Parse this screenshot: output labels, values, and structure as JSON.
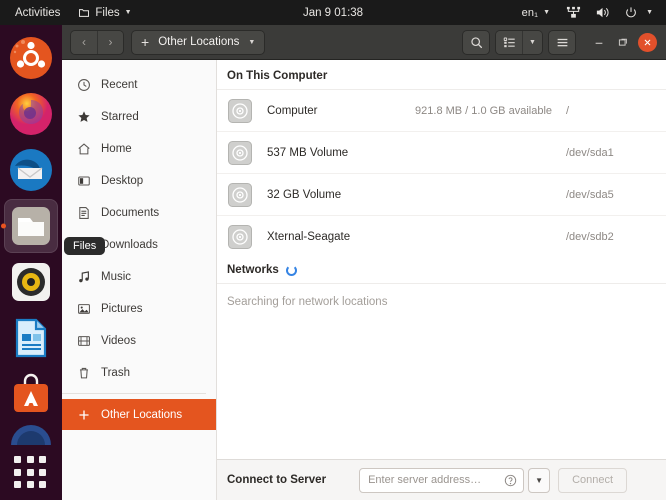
{
  "topbar": {
    "activities": "Activities",
    "app_menu": "Files",
    "app_icon": "folder-icon",
    "clock": "Jan 9  01:38",
    "language": "en₁",
    "network_icon": "network-icon",
    "volume_icon": "volume-icon",
    "power_icon": "power-icon",
    "caret_icon": "chevron-down-icon"
  },
  "dock": {
    "items": [
      {
        "name": "ubuntu-logo-icon",
        "label": "Ubuntu"
      },
      {
        "name": "firefox-icon",
        "label": "Firefox"
      },
      {
        "name": "thunderbird-icon",
        "label": "Thunderbird"
      },
      {
        "name": "files-icon",
        "label": "Files"
      },
      {
        "name": "rhythmbox-icon",
        "label": "Rhythmbox"
      },
      {
        "name": "libreoffice-writer-icon",
        "label": "LibreOffice Writer"
      },
      {
        "name": "ubuntu-software-icon",
        "label": "Ubuntu Software"
      },
      {
        "name": "help-icon",
        "label": "Help"
      }
    ],
    "show_apps_label": "Show Applications",
    "active_index": 3
  },
  "headerbar": {
    "back_icon": "chevron-left-icon",
    "forward_icon": "chevron-right-icon",
    "path_plus": "+",
    "path_label": "Other Locations",
    "path_caret_icon": "chevron-down-icon",
    "search_icon": "search-icon",
    "view_list_icon": "list-view-icon",
    "view_caret_icon": "chevron-down-icon",
    "menu_icon": "hamburger-menu-icon",
    "minimize_icon": "minimize-icon",
    "maximize_icon": "maximize-icon",
    "close_icon": "close-icon"
  },
  "sidebar": {
    "items": [
      {
        "label": "Recent",
        "icon": "clock-icon",
        "selected": false
      },
      {
        "label": "Starred",
        "icon": "star-icon",
        "selected": false
      },
      {
        "label": "Home",
        "icon": "home-icon",
        "selected": false
      },
      {
        "label": "Desktop",
        "icon": "desktop-icon",
        "selected": false
      },
      {
        "label": "Documents",
        "icon": "document-icon",
        "selected": false
      },
      {
        "label": "Downloads",
        "icon": "download-icon",
        "selected": false
      },
      {
        "label": "Music",
        "icon": "music-icon",
        "selected": false
      },
      {
        "label": "Pictures",
        "icon": "image-icon",
        "selected": false
      },
      {
        "label": "Videos",
        "icon": "video-icon",
        "selected": false
      },
      {
        "label": "Trash",
        "icon": "trash-icon",
        "selected": false
      },
      {
        "label": "Other Locations",
        "icon": "plus-icon",
        "selected": true
      }
    ],
    "tooltip": "Files"
  },
  "content": {
    "section_title": "On This Computer",
    "drives": [
      {
        "icon": "harddisk-icon",
        "name": "Computer",
        "free": "921.8 MB / 1.0 GB available",
        "device": "/"
      },
      {
        "icon": "harddisk-icon",
        "name": "537 MB Volume",
        "free": "",
        "device": "/dev/sda1"
      },
      {
        "icon": "harddisk-icon",
        "name": "32 GB Volume",
        "free": "",
        "device": "/dev/sda5"
      },
      {
        "icon": "harddisk-icon",
        "name": "Xternal-Seagate",
        "free": "",
        "device": "/dev/sdb2"
      }
    ],
    "networks_title": "Networks",
    "networks_spinner": "loading-spinner-icon",
    "networks_status": "Searching for network locations"
  },
  "footer": {
    "label": "Connect to Server",
    "input_value": "",
    "input_placeholder": "Enter server address…",
    "help_icon": "help-circle-icon",
    "dropdown_icon": "chevron-down-icon",
    "connect_label": "Connect"
  },
  "colors": {
    "ubuntu_orange": "#e4551f",
    "close_button": "#e2502b",
    "spinner_blue": "#3584e4",
    "topbar_bg": "#1a1a1a",
    "dock_bg": "#2c0a22",
    "headerbar_bg": "#3b3b39",
    "sidebar_bg": "#fafafa"
  }
}
